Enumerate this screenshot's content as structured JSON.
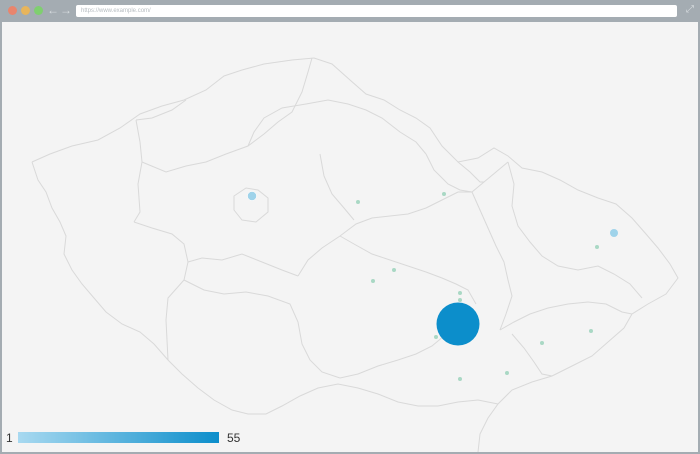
{
  "browser": {
    "url": "https://www.example.com/",
    "window_controls": [
      "close-dot",
      "minimize-dot",
      "maximize-dot"
    ],
    "nav_icons": [
      "back-arrow-icon",
      "forward-arrow-icon",
      "expand-icon"
    ]
  },
  "map": {
    "region": "Czech Republic",
    "colors": {
      "land": "#f4f4f4",
      "border": "#d9d9d9",
      "bubble_small": "#9fd3ea",
      "bubble_large": "#0c8ecb",
      "dot": "#a9d8c4"
    },
    "bubbles": [
      {
        "name": "bubble-prague",
        "value": 5
      },
      {
        "name": "bubble-brno",
        "value": 55
      },
      {
        "name": "bubble-ostrava",
        "value": 4
      },
      {
        "name": "bubble-dot-1",
        "value": 1
      },
      {
        "name": "bubble-dot-2",
        "value": 1
      },
      {
        "name": "bubble-dot-3",
        "value": 1
      },
      {
        "name": "bubble-dot-4",
        "value": 1
      },
      {
        "name": "bubble-dot-5",
        "value": 1
      },
      {
        "name": "bubble-dot-6",
        "value": 1
      },
      {
        "name": "bubble-dot-7",
        "value": 1
      },
      {
        "name": "bubble-dot-8",
        "value": 1
      },
      {
        "name": "bubble-dot-9",
        "value": 1
      },
      {
        "name": "bubble-dot-10",
        "value": 1
      },
      {
        "name": "bubble-dot-11",
        "value": 1
      },
      {
        "name": "bubble-dot-12",
        "value": 1
      }
    ]
  },
  "legend": {
    "min": "1",
    "max": "55",
    "color_low": "#a8d9f0",
    "color_high": "#0c8ecb"
  }
}
